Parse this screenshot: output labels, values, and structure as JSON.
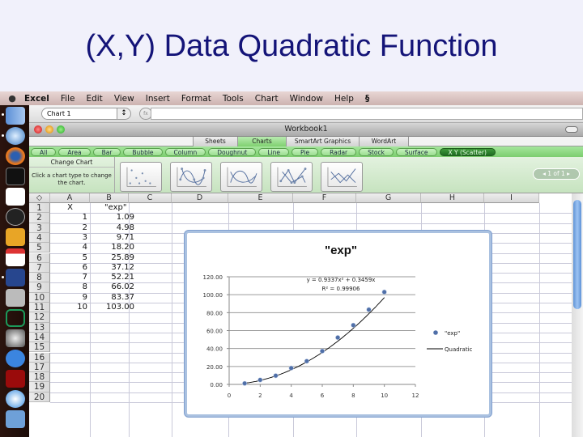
{
  "slide": {
    "title": "(X,Y) Data Quadratic Function"
  },
  "menubar": {
    "apple": "",
    "items": [
      "Excel",
      "File",
      "Edit",
      "View",
      "Insert",
      "Format",
      "Tools",
      "Chart",
      "Window",
      "Help"
    ],
    "script_icon": "script-menu-icon"
  },
  "dock": {
    "icons": [
      "finder-icon",
      "safari-icon",
      "firefox-icon",
      "terminal-icon",
      "acrobat-icon",
      "dashboard-icon",
      "sketch-icon",
      "ical-icon",
      "ical-blue-icon",
      "calculator-icon",
      "kbr-icon",
      "preferences-icon",
      "ichat-icon",
      "photobooth-icon",
      "itunes-icon",
      "preview-icon"
    ]
  },
  "formula_bar": {
    "name_box": "Chart 1",
    "stepper": "↕",
    "fx": "fx",
    "formula": ""
  },
  "window": {
    "title": "Workbook1"
  },
  "ribbon": {
    "tabs": [
      "Sheets",
      "Charts",
      "SmartArt Graphics",
      "WordArt"
    ],
    "active_tab": "Charts",
    "chart_types": [
      "All",
      "Area",
      "Bar",
      "Bubble",
      "Column",
      "Doughnut",
      "Line",
      "Pie",
      "Radar",
      "Stock",
      "Surface",
      "X Y (Scatter)"
    ],
    "selected_type": "X Y (Scatter)",
    "change_chart": {
      "heading": "Change Chart",
      "hint": "Click a chart type to change the chart."
    },
    "gallery": [
      "scatter-markers-only",
      "scatter-smooth-lines-markers",
      "scatter-smooth-lines",
      "scatter-straight-lines-markers",
      "scatter-straight-lines"
    ],
    "pager": {
      "prev": "◂",
      "label": "1 of 1",
      "next": "▸"
    }
  },
  "sheet": {
    "corner": "◇",
    "columns": [
      "A",
      "B",
      "C",
      "D",
      "E",
      "F",
      "G",
      "H",
      "I"
    ],
    "rows": [
      "1",
      "2",
      "3",
      "4",
      "5",
      "6",
      "7",
      "8",
      "9",
      "10",
      "11",
      "12",
      "13",
      "14",
      "15",
      "16",
      "17",
      "18",
      "19",
      "20"
    ],
    "header_row": {
      "A": "X",
      "B": "\"exp\""
    },
    "data": [
      {
        "x": "1",
        "y": "1.09"
      },
      {
        "x": "2",
        "y": "4.98"
      },
      {
        "x": "3",
        "y": "9.71"
      },
      {
        "x": "4",
        "y": "18.20"
      },
      {
        "x": "5",
        "y": "25.89"
      },
      {
        "x": "6",
        "y": "37.12"
      },
      {
        "x": "7",
        "y": "52.21"
      },
      {
        "x": "8",
        "y": "66.02"
      },
      {
        "x": "9",
        "y": "83.37"
      },
      {
        "x": "10",
        "y": "103.00"
      }
    ]
  },
  "chart_data": {
    "type": "scatter",
    "title": "\"exp\"",
    "xlabel": "",
    "ylabel": "",
    "x": [
      1,
      2,
      3,
      4,
      5,
      6,
      7,
      8,
      9,
      10
    ],
    "series": [
      {
        "name": "\"exp\"",
        "kind": "markers",
        "color": "#4f6fa8",
        "values": [
          1.09,
          4.98,
          9.71,
          18.2,
          25.89,
          37.12,
          52.21,
          66.02,
          83.37,
          103.0
        ]
      },
      {
        "name": "Quadratic",
        "kind": "trendline",
        "color": "#000000",
        "coefficients": {
          "a": 0.9337,
          "b": 0.3459
        }
      }
    ],
    "equation": "y = 0.9337x² + 0.3459x",
    "r_squared": "R² = 0.99906",
    "xlim": [
      0,
      12
    ],
    "ylim": [
      0,
      120
    ],
    "x_ticks": [
      "0",
      "2",
      "4",
      "6",
      "8",
      "10",
      "12"
    ],
    "y_ticks": [
      "0.00",
      "20.00",
      "40.00",
      "60.00",
      "80.00",
      "100.00",
      "120.00"
    ],
    "grid": "horizontal",
    "legend": "right"
  }
}
